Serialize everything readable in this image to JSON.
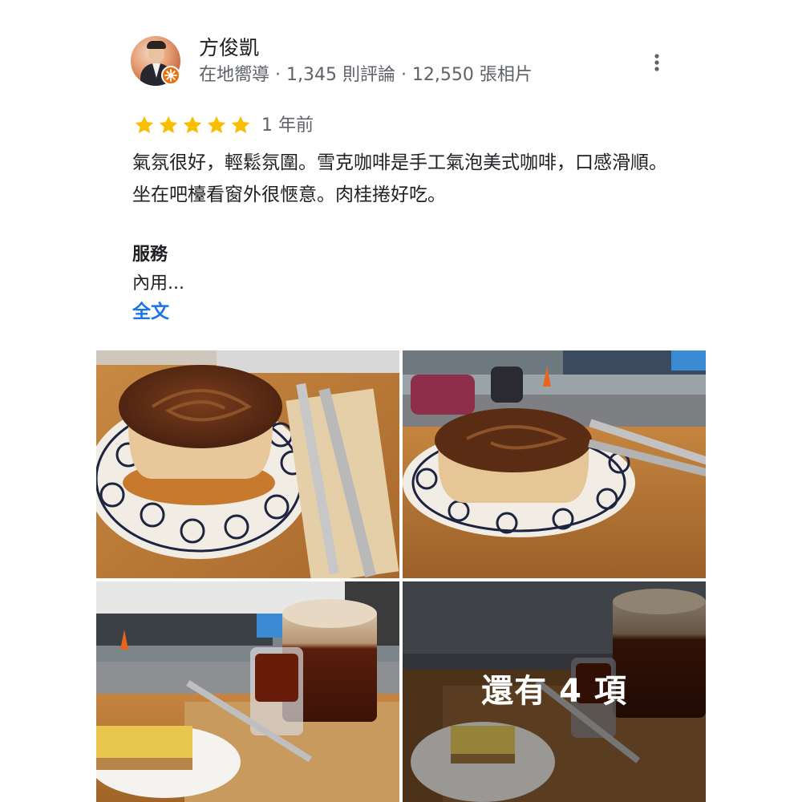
{
  "author": {
    "name": "方俊凱",
    "meta": "在地嚮導 · 1,345 則評論 · 12,550 張相片",
    "avatar_icon": "profile-photo",
    "badge_icon": "local-guide-badge-icon"
  },
  "rating": {
    "stars": 5,
    "max_stars": 5,
    "time": "1 年前",
    "star_color": "#fbbc04"
  },
  "review": {
    "text": "氣氛很好，輕鬆氛圍。雪克咖啡是手工氣泡美式咖啡，口感滑順。坐在吧檯看窗外很愜意。肉桂捲好吃。",
    "section_title": "服務",
    "section_value": "內用...",
    "more_label": "全文",
    "link_color": "#1a73e8"
  },
  "photos": {
    "items": [
      {
        "alt": "cinnamon-roll-photo-1"
      },
      {
        "alt": "cinnamon-roll-photo-2"
      },
      {
        "alt": "coffee-and-cheesecake-photo"
      },
      {
        "alt": "more-photos-tile"
      }
    ],
    "more_overlay_label": "還有 4 項"
  },
  "menu_icon": "more-vert-icon"
}
